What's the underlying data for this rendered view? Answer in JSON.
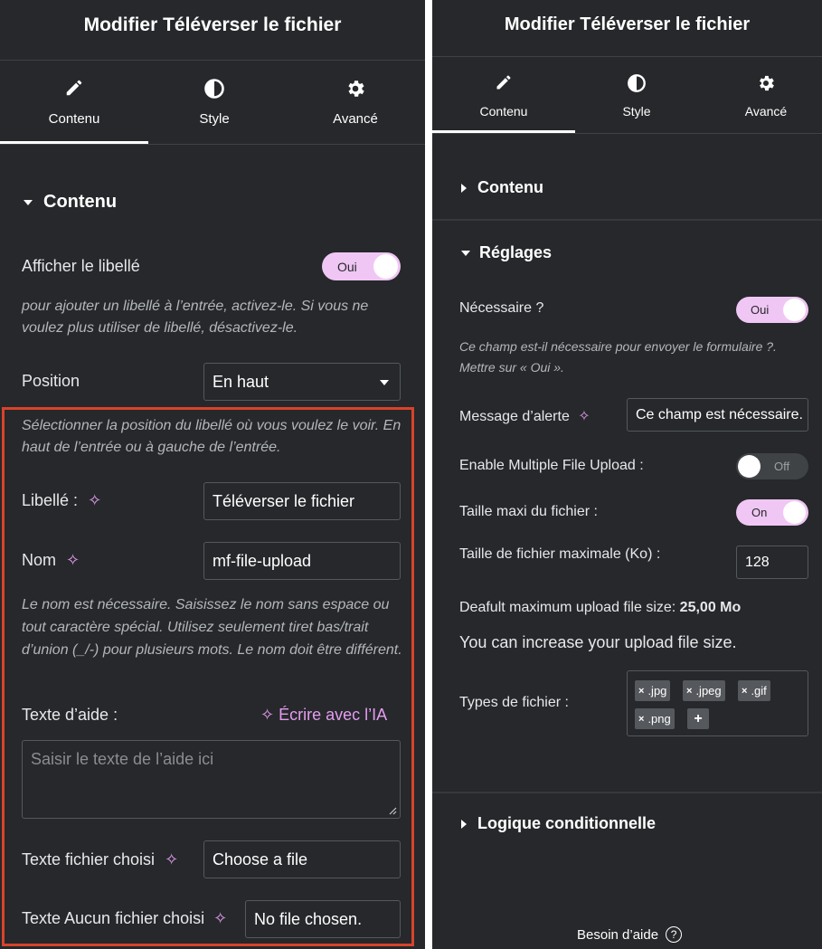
{
  "left": {
    "header": "Modifier Téléverser le fichier",
    "tabs": [
      {
        "label": "Contenu",
        "icon": "pencil-icon",
        "active": true
      },
      {
        "label": "Style",
        "icon": "half-circle-icon",
        "active": false
      },
      {
        "label": "Avancé",
        "icon": "gear-icon",
        "active": false
      }
    ],
    "section_title": "Contenu",
    "show_label": {
      "label": "Afficher le libellé",
      "toggle": "Oui"
    },
    "show_label_hint": "pour ajouter un libellé à l’entrée, activez-le. Si vous ne voulez plus utiliser de libellé, désactivez-le.",
    "position": {
      "label": "Position",
      "value": "En haut"
    },
    "position_hint": "Sélectionner la position du libellé où vous voulez le voir. En haut de l’entrée ou à gauche de l’entrée.",
    "label_field": {
      "label": "Libellé :",
      "value": "Téléverser le fichier"
    },
    "name_field": {
      "label": "Nom",
      "value": "mf-file-upload"
    },
    "name_hint": "Le nom est nécessaire. Saisissez le nom sans espace ou tout caractère spécial. Utilisez seulement tiret bas/trait d’union (_/-) pour plusieurs mots. Le nom doit être différent.",
    "help_text": {
      "label": "Texte d’aide :",
      "ai_link": "Écrire avec l’IA",
      "placeholder": "Saisir le texte de l’aide ici"
    },
    "chosen_file_text": {
      "label": "Texte fichier choisi",
      "value": "Choose a file"
    },
    "no_file_text": {
      "label": "Texte Aucun fichier choisi",
      "value": "No file chosen."
    },
    "highlight_color": "#d8432a"
  },
  "right": {
    "header": "Modifier Téléverser le fichier",
    "tabs": [
      {
        "label": "Contenu",
        "icon": "pencil-icon",
        "active": true
      },
      {
        "label": "Style",
        "icon": "half-circle-icon",
        "active": false
      },
      {
        "label": "Avancé",
        "icon": "gear-icon",
        "active": false
      }
    ],
    "section_content": "Contenu",
    "section_settings": "Réglages",
    "required": {
      "label": "Nécessaire ?",
      "toggle": "Oui"
    },
    "required_hint": "Ce champ est-il nécessaire pour envoyer le formulaire ?. Mettre sur « Oui ».",
    "alert_message": {
      "label": "Message d’alerte",
      "value": "Ce champ est nécessaire."
    },
    "multiple_upload": {
      "label": "Enable Multiple File Upload :",
      "toggle": "Off"
    },
    "max_size_toggle": {
      "label": "Taille maxi du fichier :",
      "toggle": "On"
    },
    "max_size_value": {
      "label": "Taille de fichier maximale (Ko) :",
      "value": "128"
    },
    "default_max": {
      "label": "Deafult maximum upload file size:",
      "value": "25,00 Mo"
    },
    "increase_text": "You can increase your upload file size.",
    "file_types": {
      "label": "Types de fichier :",
      "items": [
        ".jpg",
        ".jpeg",
        ".gif",
        ".png"
      ],
      "add": "+"
    },
    "section_conditional": "Logique conditionnelle",
    "help": "Besoin d’aide"
  },
  "colors": {
    "panel_bg": "#26282b",
    "toggle_on": "#f0c6f4",
    "ai_accent": "#e49cf0",
    "highlight": "#d8432a"
  }
}
